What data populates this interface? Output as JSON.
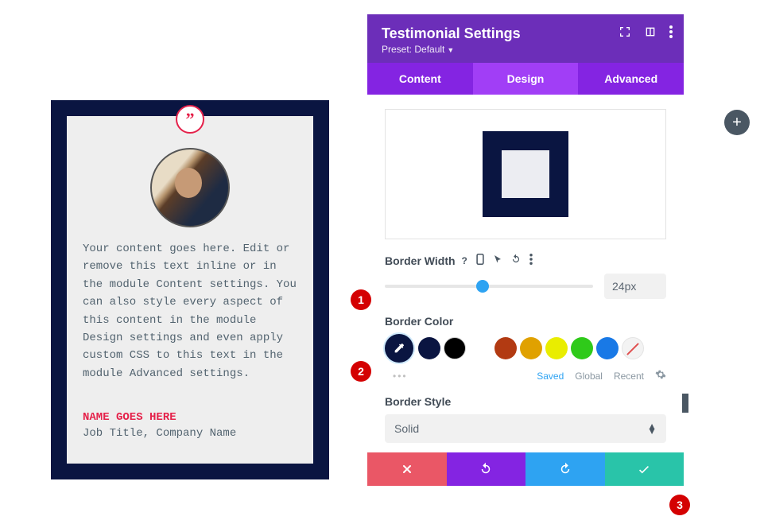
{
  "testimonial": {
    "quote_glyph": "”",
    "content": "Your content goes here. Edit or remove this text inline or in the module Content settings. You can also style every aspect of this content in the module Design settings and even apply custom CSS to this text in the module Advanced settings.",
    "name": "NAME GOES HERE",
    "job": "Job Title, Company Name"
  },
  "panel": {
    "title": "Testimonial Settings",
    "preset": "Preset: Default",
    "tabs": {
      "content": "Content",
      "design": "Design",
      "advanced": "Advanced"
    },
    "border_width": {
      "label": "Border Width",
      "value": "24px"
    },
    "border_color": {
      "label": "Border Color",
      "swatches": [
        "#0a1541",
        "#000000",
        "#ffffff",
        "#b23a12",
        "#e0a100",
        "#e9ed00",
        "#2fca1a",
        "#1979e6",
        "#8a00e6"
      ]
    },
    "meta": {
      "saved": "Saved",
      "global": "Global",
      "recent": "Recent"
    },
    "border_style": {
      "label": "Border Style",
      "value": "Solid"
    }
  },
  "annotations": {
    "n1": "1",
    "n2": "2",
    "n3": "3"
  },
  "floating_add": "+"
}
